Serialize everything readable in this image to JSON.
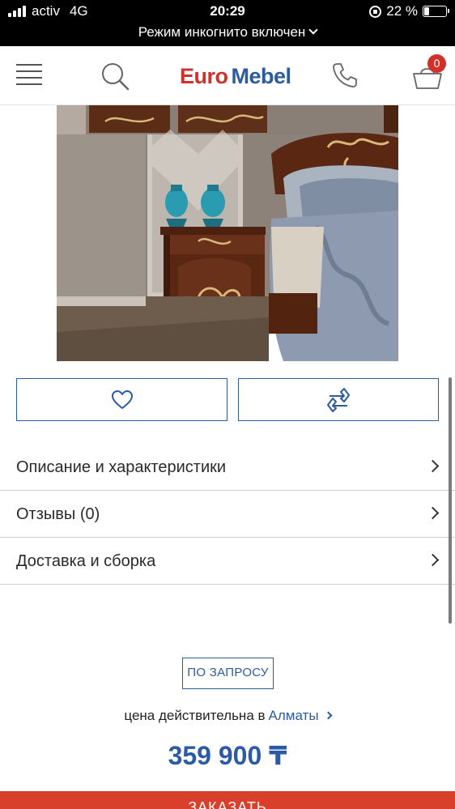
{
  "status_bar": {
    "carrier": "activ",
    "network": "4G",
    "time": "20:29",
    "battery_text": "22 %",
    "battery_level": 0.22,
    "incognito_text": "Режим инкогнито включен"
  },
  "header": {
    "logo_part1": "Euro",
    "logo_part2": "Mebel",
    "cart_count": "0"
  },
  "accordion": [
    {
      "label": "Описание и характеристики"
    },
    {
      "label": "Отзывы (0)"
    },
    {
      "label": "Доставка и сборка"
    }
  ],
  "pricing": {
    "request_label": "ПО ЗАПРОСУ",
    "valid_text": "цена действительна в",
    "city": "Алматы",
    "price": "359 900 ₸"
  },
  "order_button": {
    "label": "ЗАКАЗАТЬ"
  },
  "colors": {
    "brand_blue": "#2b5ba5",
    "brand_red": "#d0312d",
    "order_red": "#d8402b"
  }
}
